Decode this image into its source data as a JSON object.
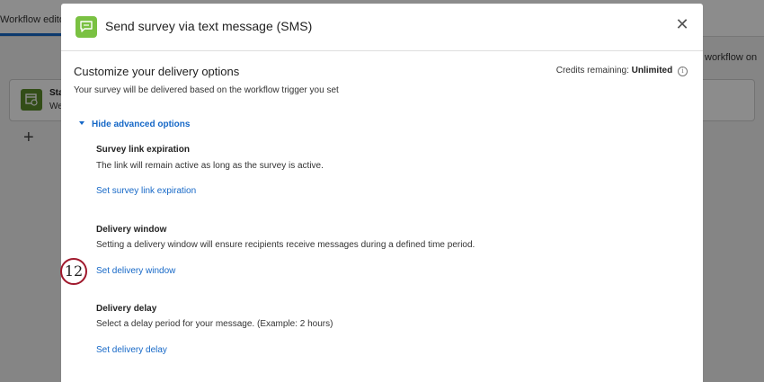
{
  "background": {
    "tab_label": "Workflow editor",
    "right_text": "workflow on",
    "card_title": "Sta",
    "card_sub": "We",
    "plus_symbol": "+"
  },
  "modal": {
    "title": "Send survey via text message (SMS)",
    "close_symbol": "✕",
    "section_title": "Customize your delivery options",
    "credits_label": "Credits remaining:",
    "credits_value": "Unlimited",
    "info_symbol": "i",
    "section_subtitle": "Your survey will be delivered based on the workflow trigger you set",
    "toggle_label": "Hide advanced options",
    "options": [
      {
        "title": "Survey link expiration",
        "description": "The link will remain active as long as the survey is active.",
        "link": "Set survey link expiration"
      },
      {
        "title": "Delivery window",
        "description": "Setting a delivery window will ensure recipients receive messages during a defined time period.",
        "link": "Set delivery window"
      },
      {
        "title": "Delivery delay",
        "description": "Select a delay period for your message. (Example: 2 hours)",
        "link": "Set delivery delay"
      }
    ]
  },
  "step_marker": "12",
  "colors": {
    "accent_link": "#1668c7",
    "sms_icon_green": "#7ac142",
    "marker_red": "#a0182c"
  },
  "icons": {
    "sms": "sms-chat-icon",
    "close": "close-icon",
    "info": "info-icon",
    "caret": "caret-down-icon",
    "calendar": "calendar-clock-icon"
  }
}
